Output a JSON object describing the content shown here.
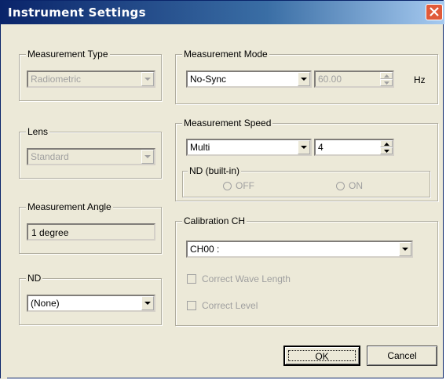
{
  "window": {
    "title": "Instrument Settings"
  },
  "measurement_type": {
    "label": "Measurement Type",
    "value": "Radiometric"
  },
  "lens": {
    "label": "Lens",
    "value": "Standard"
  },
  "measurement_angle": {
    "label": "Measurement Angle",
    "value": "1 degree"
  },
  "nd": {
    "label": "ND",
    "value": "(None)"
  },
  "measurement_mode": {
    "label": "Measurement Mode",
    "mode": "No-Sync",
    "frequency": "60.00",
    "unit": "Hz"
  },
  "measurement_speed": {
    "label": "Measurement Speed",
    "speed": "Multi",
    "count": "4"
  },
  "nd_builtin": {
    "label": "ND (built-in)",
    "off": "OFF",
    "on": "ON"
  },
  "calibration": {
    "label": "Calibration CH",
    "channel": "CH00 :",
    "correct_wave": "Correct Wave Length",
    "correct_level": "Correct Level"
  },
  "buttons": {
    "ok": "OK",
    "cancel": "Cancel"
  }
}
